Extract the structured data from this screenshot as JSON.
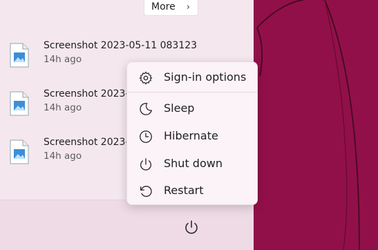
{
  "start": {
    "more_label": "More",
    "recent_files": [
      {
        "name": "Screenshot 2023-05-11 083123",
        "time": "14h ago"
      },
      {
        "name": "Screenshot 2023-0",
        "time": "14h ago"
      },
      {
        "name": "Screenshot 2023-0",
        "time": "14h ago"
      }
    ]
  },
  "power_menu": {
    "items": [
      {
        "label": "Sign-in options",
        "icon": "gear-icon"
      },
      {
        "label": "Sleep",
        "icon": "moon-icon"
      },
      {
        "label": "Hibernate",
        "icon": "clock-icon"
      },
      {
        "label": "Shut down",
        "icon": "power-icon"
      },
      {
        "label": "Restart",
        "icon": "restart-icon"
      }
    ]
  },
  "colors": {
    "wallpaper": "#8d0f45",
    "panel": "#f4e7ee",
    "menu": "#fbf3f7",
    "file_icon_accent": "#3b8fd6"
  }
}
